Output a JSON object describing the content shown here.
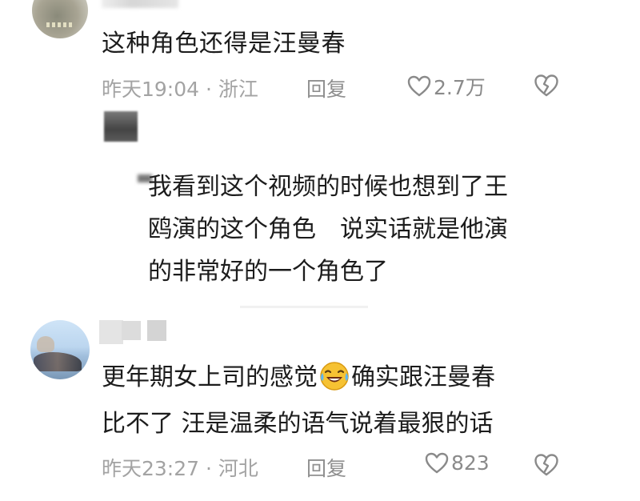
{
  "comments": [
    {
      "text": "这种角色还得是汪曼春",
      "time_location": "昨天19:04 · 浙江",
      "reply_label": "回复",
      "likes": "2.7万"
    },
    {
      "line1_before_emoji": "更年期女上司的感觉",
      "emoji": "laughing-crying-emoji",
      "line1_after_emoji": "确实跟汪曼春",
      "line2": "比不了 汪是温柔的语气说着最狠的话",
      "time_location": "昨天23:27 · 河北",
      "reply_label": "回复",
      "likes": "823"
    }
  ],
  "reply": {
    "lines": [
      "我看到这个视频的时候也想到了王",
      "鸥演的这个角色　说实话就是他演",
      "的非常好的一个角色了"
    ]
  },
  "colors": {
    "text": "#1c1c1c",
    "meta": "#a3a3a3",
    "icon": "#8a8a8a"
  }
}
